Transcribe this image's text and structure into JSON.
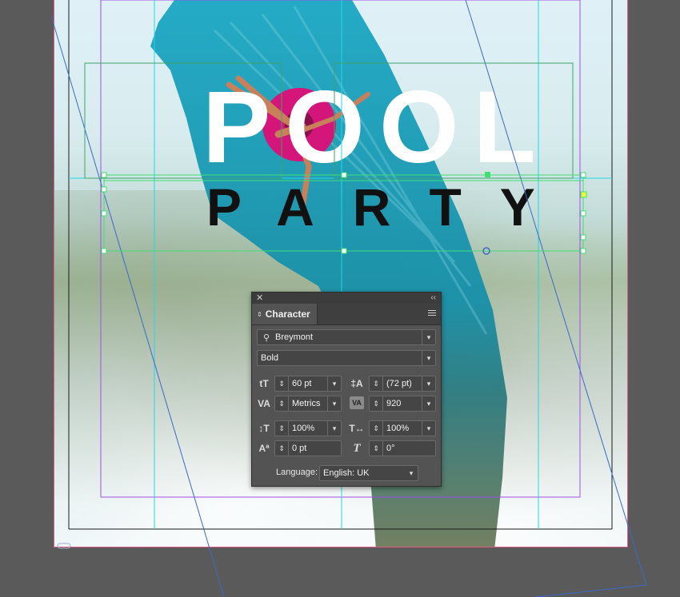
{
  "artwork": {
    "title_line1": "POOL",
    "title_line2": "PARTY"
  },
  "character_panel": {
    "tab_label": "Character",
    "font_family": "Breymont",
    "font_style": "Bold",
    "font_size": "60 pt",
    "leading": "(72 pt)",
    "kerning": "Metrics",
    "tracking": "920",
    "vertical_scale": "100%",
    "horizontal_scale": "100%",
    "baseline_shift": "0 pt",
    "skew": "0°",
    "language_label": "Language:",
    "language_value": "English: UK"
  },
  "colors": {
    "pasteboard": "#5a5a5a",
    "panel_bg": "#535353",
    "page_border": "#e35c86",
    "brush_teal": "#1ea3bf",
    "float_pink": "#d4157a",
    "guide_cyan": "#21d8e8",
    "margin_purple": "#a050e6",
    "frame_green": "#3ee070"
  },
  "icons": {
    "panel_close": "close-icon",
    "panel_collapse": "double-chevron-icon",
    "panel_menu": "hamburger-menu-icon",
    "font_search": "search-icon",
    "font_size": "font-size-icon",
    "leading": "leading-icon",
    "kerning": "kerning-icon",
    "tracking": "tracking-icon",
    "vertical_scale": "vertical-scale-icon",
    "horizontal_scale": "horizontal-scale-icon",
    "baseline_shift": "baseline-shift-icon",
    "skew": "skew-icon"
  }
}
